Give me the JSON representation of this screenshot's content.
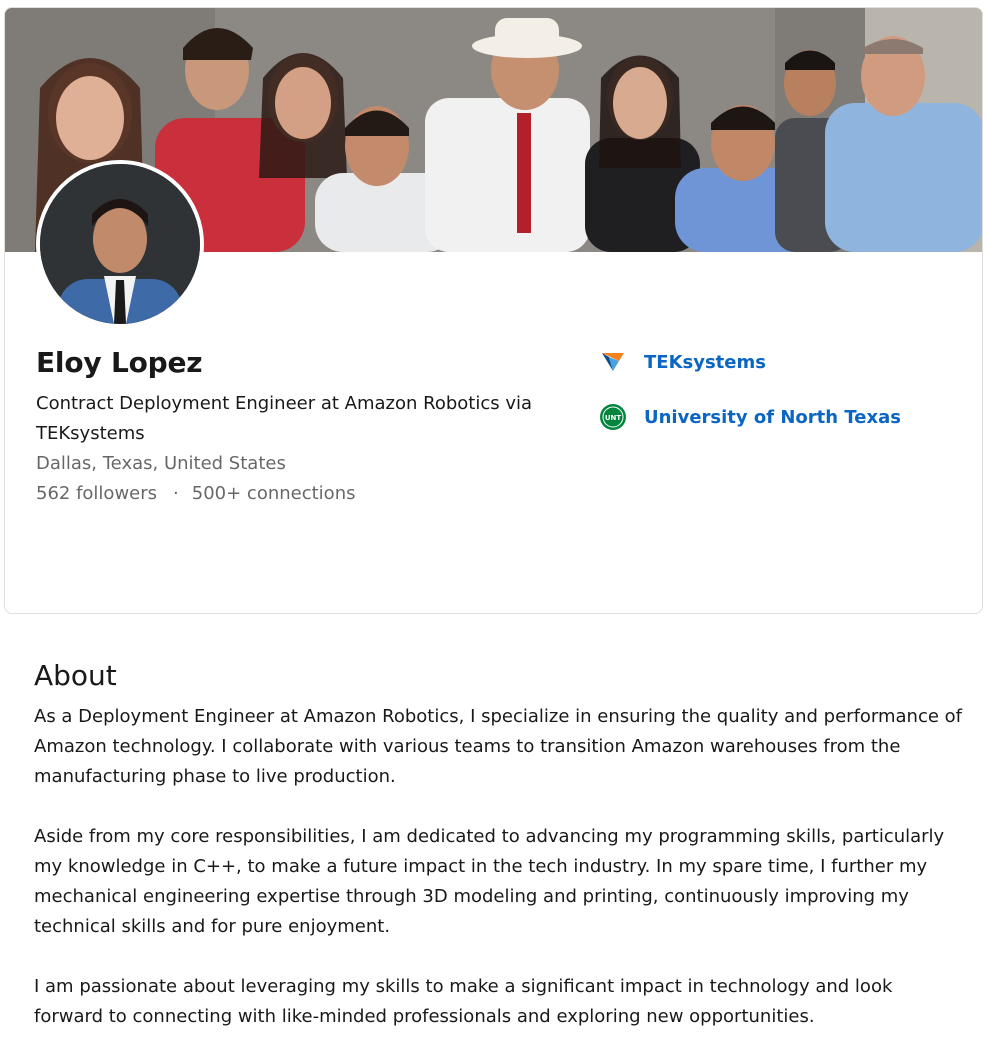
{
  "profile": {
    "name": "Eloy Lopez",
    "headline": "Contract Deployment Engineer at Amazon Robotics via TEKsystems",
    "location": "Dallas, Texas, United States",
    "followers": "562 followers",
    "separator": "·",
    "connections": "500+ connections"
  },
  "orgs": [
    {
      "name": "TEKsystems",
      "icon": "teksystems-logo-icon"
    },
    {
      "name": "University of North Texas",
      "icon": "unt-logo-icon",
      "icon_text": "UNT"
    }
  ],
  "about": {
    "title": "About",
    "paragraphs": [
      "As a Deployment Engineer at Amazon Robotics, I specialize in ensuring the quality and performance of Amazon technology. I collaborate with various teams to transition Amazon warehouses from the manufacturing phase to live production.",
      "Aside from my core responsibilities, I am dedicated to advancing my programming skills, particularly my knowledge in C++, to make a future impact in the tech industry. In my spare time, I further my mechanical engineering expertise through 3D modeling and printing, continuously improving my technical skills and for pure enjoyment.",
      "I am passionate about leveraging my skills to make a significant impact in technology and look forward to connecting with like-minded professionals and exploring new opportunities."
    ]
  },
  "colors": {
    "link": "#0a66c2",
    "secondary_text": "#666666",
    "unt_green": "#00853e"
  }
}
